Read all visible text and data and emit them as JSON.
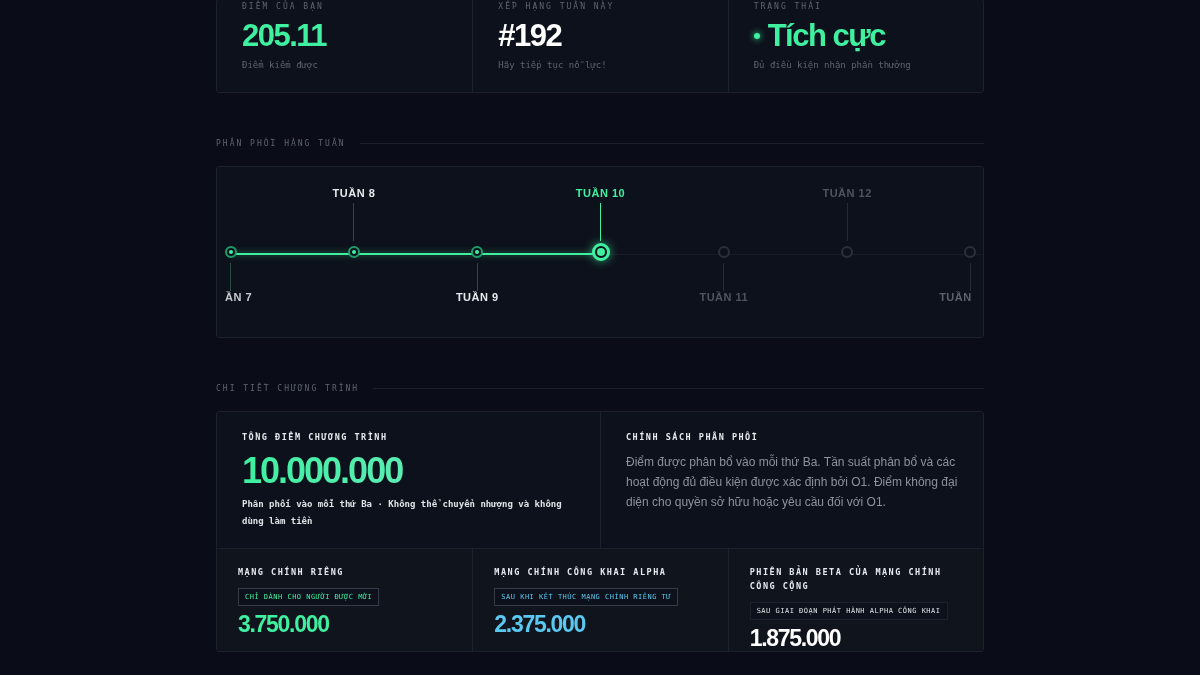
{
  "stats": [
    {
      "kind": "score",
      "label": "ĐIỂM CỦA BẠN",
      "value": "205.11",
      "caption": "Điểm kiếm được"
    },
    {
      "kind": "rank",
      "label": "XẾP HẠNG TUẦN NÀY",
      "value": "#192",
      "caption": "Hãy tiếp tục nỗ lực!"
    },
    {
      "kind": "status",
      "label": "TRẠNG THÁI",
      "value": "Tích cực",
      "caption": "Đủ điều kiện nhận phần thưởng"
    }
  ],
  "weekly": {
    "heading": "PHÂN PHỐI HÀNG TUẦN",
    "weeks": [
      {
        "label": "ẦN 7",
        "reached": true,
        "selected": false,
        "edge": true
      },
      {
        "label": "TUẦN 8",
        "reached": true,
        "selected": false,
        "edge": false
      },
      {
        "label": "TUẦN 9",
        "reached": true,
        "selected": false,
        "edge": false
      },
      {
        "label": "TUẦN 10",
        "reached": true,
        "selected": true,
        "edge": false
      },
      {
        "label": "TUẦN 11",
        "reached": false,
        "selected": false,
        "edge": false
      },
      {
        "label": "TUẦN 12",
        "reached": false,
        "selected": false,
        "edge": false
      },
      {
        "label": "TUẦN",
        "reached": false,
        "selected": false,
        "edge": true
      }
    ]
  },
  "details": {
    "heading": "CHI TIẾT CHƯƠNG TRÌNH",
    "total": {
      "label": "TỔNG ĐIỂM CHƯƠNG TRÌNH",
      "value": "10.000.000",
      "caption": "Phân phối vào mỗi thứ Ba · Không thể chuyển nhượng và không dùng làm tiền"
    },
    "policy": {
      "label": "CHÍNH SÁCH PHÂN PHỐI",
      "text": "Điểm được phân bổ vào mỗi thứ Ba. Tần suất phân bổ và các hoạt động đủ điều kiện được xác định bởi O1. Điểm không đại diện cho quyền sở hữu hoặc yêu cầu đối với O1."
    },
    "phases": [
      {
        "kind": "private",
        "label": "MẠNG CHÍNH RIÊNG",
        "tag": "CHỈ DÀNH CHO NGƯỜI ĐƯỢC MỜI",
        "value": "3.750.000"
      },
      {
        "kind": "alpha",
        "label": "MẠNG CHÍNH CÔNG KHAI ALPHA",
        "tag": "SAU KHI KẾT THÚC MẠNG CHÍNH RIÊNG TƯ",
        "value": "2.375.000"
      },
      {
        "kind": "beta",
        "label": "PHIÊN BẢN BETA CỦA MẠNG CHÍNH CÔNG CỘNG",
        "tag": "SAU GIAI ĐOẠN PHÁT HÀNH ALPHA CÔNG KHAI",
        "value": "1.875.000"
      }
    ]
  }
}
